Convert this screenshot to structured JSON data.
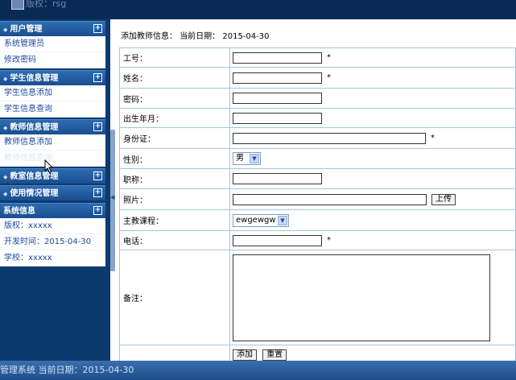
{
  "header": {
    "rights_text": "版权：rsg"
  },
  "sidebar": {
    "sections": [
      {
        "title": "用户管理",
        "items": [
          "系统管理员",
          "修改密码"
        ]
      },
      {
        "title": "学生信息管理",
        "items": [
          "学生信息添加",
          "学生信息查询"
        ]
      },
      {
        "title": "教师信息管理",
        "items": [
          "教师信息添加",
          "教师信息查询"
        ]
      },
      {
        "title": "教室信息管理",
        "items": []
      },
      {
        "title": "使用情况管理",
        "items": []
      }
    ],
    "sysinfo": {
      "title": "系统信息",
      "rows": [
        "版权：xxxxx",
        "开发时间：2015-04-30",
        "学校：xxxxx"
      ]
    }
  },
  "main": {
    "breadcrumb": "添加教师信息： 当前日期： 2015-04-30",
    "fields": {
      "gonghao": {
        "label": "工号：",
        "required": "*"
      },
      "xingming": {
        "label": "姓名：",
        "required": "*"
      },
      "mima": {
        "label": "密码："
      },
      "birth": {
        "label": "出生年月："
      },
      "idcard": {
        "label": "身份证：",
        "required": "*"
      },
      "gender": {
        "label": "性别：",
        "value": "男"
      },
      "title": {
        "label": "职称："
      },
      "photo": {
        "label": "照片：",
        "upload_label": "上传"
      },
      "course": {
        "label": "主教课程：",
        "value": "ewgewgw"
      },
      "phone": {
        "label": "电话：",
        "required": "*"
      },
      "remark": {
        "label": "备注："
      }
    },
    "buttons": {
      "add": "添加",
      "reset": "重置"
    }
  },
  "statusbar": {
    "text": "管理系统 当前日期：2015-04-30"
  }
}
